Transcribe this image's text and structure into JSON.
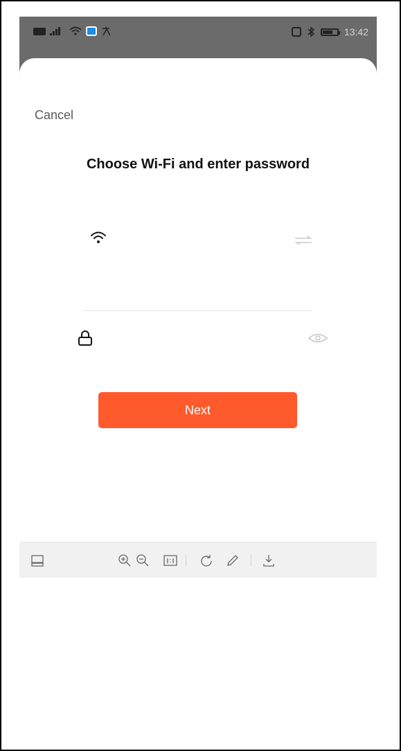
{
  "status_bar": {
    "time": "13:42",
    "network": "4G",
    "icons": [
      "hd-icon",
      "cellular-signal-icon",
      "wifi-signal-icon",
      "app-notification-icon",
      "translate-icon",
      "nfc-icon",
      "bluetooth-icon",
      "battery-icon"
    ]
  },
  "header": {
    "cancel_label": "Cancel",
    "title": "Choose Wi-Fi and enter password"
  },
  "form": {
    "wifi_icon": "wifi-icon",
    "switch_network_icon": "swap-arrows-icon",
    "wifi_value": "",
    "password_icon": "lock-icon",
    "password_value": "",
    "password_placeholder": "",
    "toggle_visibility_icon": "eye-icon"
  },
  "actions": {
    "next_label": "Next"
  },
  "viewer_toolbar": {
    "icons": [
      "thumbnail-icon",
      "zoom-in-icon",
      "zoom-out-icon",
      "actual-size-icon",
      "rotate-icon",
      "edit-icon",
      "download-icon"
    ],
    "actual_size_label": "1:1"
  },
  "colors": {
    "accent": "#ff5a2c",
    "status_bar_bg": "#6b6b6b",
    "text_primary": "#111111",
    "text_secondary": "#5a5a5a"
  }
}
